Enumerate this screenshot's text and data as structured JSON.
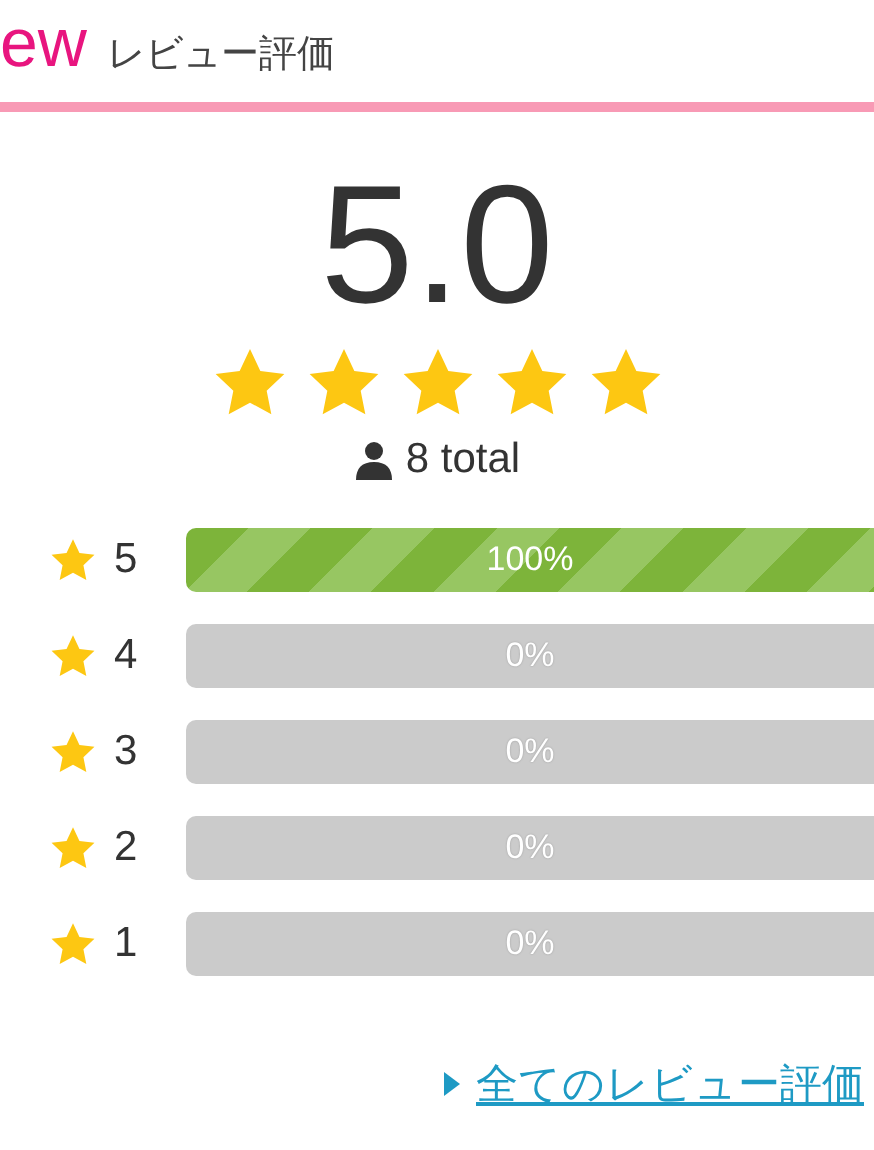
{
  "header": {
    "title_fragment": "ew",
    "subtitle": "レビュー評価"
  },
  "summary": {
    "score": "5.0",
    "stars": 5,
    "total": "8 total"
  },
  "breakdown": [
    {
      "rating": "5",
      "level": 1,
      "percent": "100%"
    },
    {
      "rating": "4",
      "level": 0,
      "percent": "0%"
    },
    {
      "rating": "3",
      "level": 0,
      "percent": "0%"
    },
    {
      "rating": "2",
      "level": 0,
      "percent": "0%"
    },
    {
      "rating": "1",
      "level": 0,
      "percent": "0%"
    }
  ],
  "link": "全てのレビュー評価"
}
